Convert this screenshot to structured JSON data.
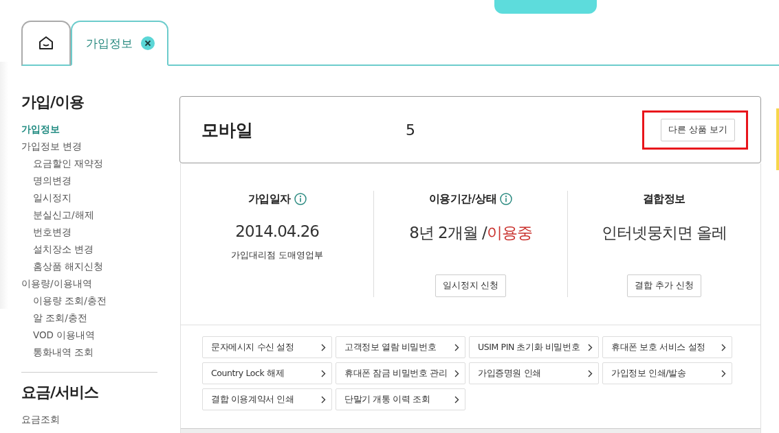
{
  "tabs": [
    {
      "kind": "home",
      "selected": false
    },
    {
      "kind": "page",
      "label": "가입정보",
      "selected": true,
      "closable": true
    }
  ],
  "sidebar": {
    "sections": [
      {
        "title": "가입/이용",
        "items": [
          {
            "label": "가입정보",
            "selected": true
          },
          {
            "label": "가입정보 변경",
            "selected": false,
            "children": [
              {
                "label": "요금할인 재약정",
                "selected": false
              },
              {
                "label": "명의변경",
                "selected": false
              },
              {
                "label": "일시정지",
                "selected": false
              },
              {
                "label": "분실신고/해제",
                "selected": false
              },
              {
                "label": "번호변경",
                "selected": false
              },
              {
                "label": "설치장소 변경",
                "selected": false
              },
              {
                "label": "홈상품 해지신청",
                "selected": false
              }
            ]
          },
          {
            "label": "이용량/이용내역",
            "selected": false,
            "children": [
              {
                "label": "이용량 조회/충전",
                "selected": false
              },
              {
                "label": "알 조회/충전",
                "selected": false
              },
              {
                "label": "VOD 이용내역",
                "selected": false
              },
              {
                "label": "통화내역 조회",
                "selected": false
              }
            ]
          }
        ]
      },
      {
        "title": "요금/서비스",
        "items": [
          {
            "label": "요금조회",
            "selected": false
          }
        ]
      }
    ]
  },
  "product": {
    "title": "모바일",
    "fragment": "5",
    "button": "다른 상품 보기",
    "highlighted": true
  },
  "stats": [
    {
      "title": "가입일자",
      "info": true,
      "value": "2014.04.26",
      "sub": "가입대리점 도매영업부"
    },
    {
      "title": "이용기간/상태",
      "info": true,
      "value": "8년 2개월 /",
      "status": "이용중",
      "button": "일시정지 신청"
    },
    {
      "title": "결합정보",
      "info": false,
      "value": "인터넷뭉치면 올레",
      "button": "결합 추가 신청"
    }
  ],
  "links": [
    "문자메시지 수신 설정",
    "고객정보 열람 비밀번호",
    "USIM PIN 초기화 비밀번호",
    "휴대폰 보호 서비스 설정",
    "Country Lock 해제",
    "휴대폰 잠금 비밀번호 관리",
    "가입증명원 인쇄",
    "가입정보 인쇄/발송",
    "결합 이용계약서 인쇄",
    "단말기 개통 이력 조회"
  ]
}
